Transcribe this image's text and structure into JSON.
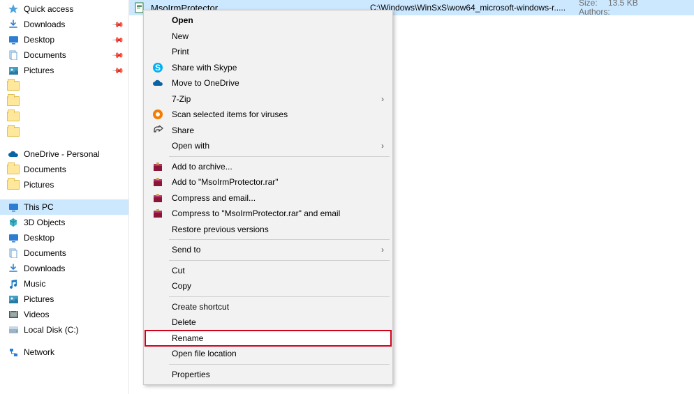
{
  "sidebar": {
    "quick_access": "Quick access",
    "qa_items": [
      {
        "label": "Downloads"
      },
      {
        "label": "Desktop"
      },
      {
        "label": "Documents"
      },
      {
        "label": "Pictures"
      }
    ],
    "empty_folders": [
      "",
      "",
      "",
      ""
    ],
    "onedrive": "OneDrive - Personal",
    "onedrive_items": [
      {
        "label": "Documents"
      },
      {
        "label": "Pictures"
      }
    ],
    "this_pc": "This PC",
    "thispc_items": [
      {
        "label": "3D Objects"
      },
      {
        "label": "Desktop"
      },
      {
        "label": "Documents"
      },
      {
        "label": "Downloads"
      },
      {
        "label": "Music"
      },
      {
        "label": "Pictures"
      },
      {
        "label": "Videos"
      },
      {
        "label": "Local Disk (C:)"
      }
    ],
    "network": "Network"
  },
  "file": {
    "name": "MsoIrmProtector",
    "path": "C:\\Windows\\WinSxS\\wow64_microsoft-windows-r.....",
    "size_label": "Size:",
    "size_value": "13.5 KB",
    "authors_label": "Authors:"
  },
  "menu": {
    "open": "Open",
    "new": "New",
    "print": "Print",
    "skype": "Share with Skype",
    "onedrive": "Move to OneDrive",
    "zip": "7-Zip",
    "scan": "Scan selected items for viruses",
    "share": "Share",
    "open_with": "Open with",
    "archive_add": "Add to archive...",
    "archive_rar": "Add to \"MsoIrmProtector.rar\"",
    "compress_email": "Compress and email...",
    "compress_rar_email": "Compress to \"MsoIrmProtector.rar\" and email",
    "restore": "Restore previous versions",
    "send_to": "Send to",
    "cut": "Cut",
    "copy": "Copy",
    "create_shortcut": "Create shortcut",
    "delete": "Delete",
    "rename": "Rename",
    "open_location": "Open file location",
    "properties": "Properties"
  }
}
